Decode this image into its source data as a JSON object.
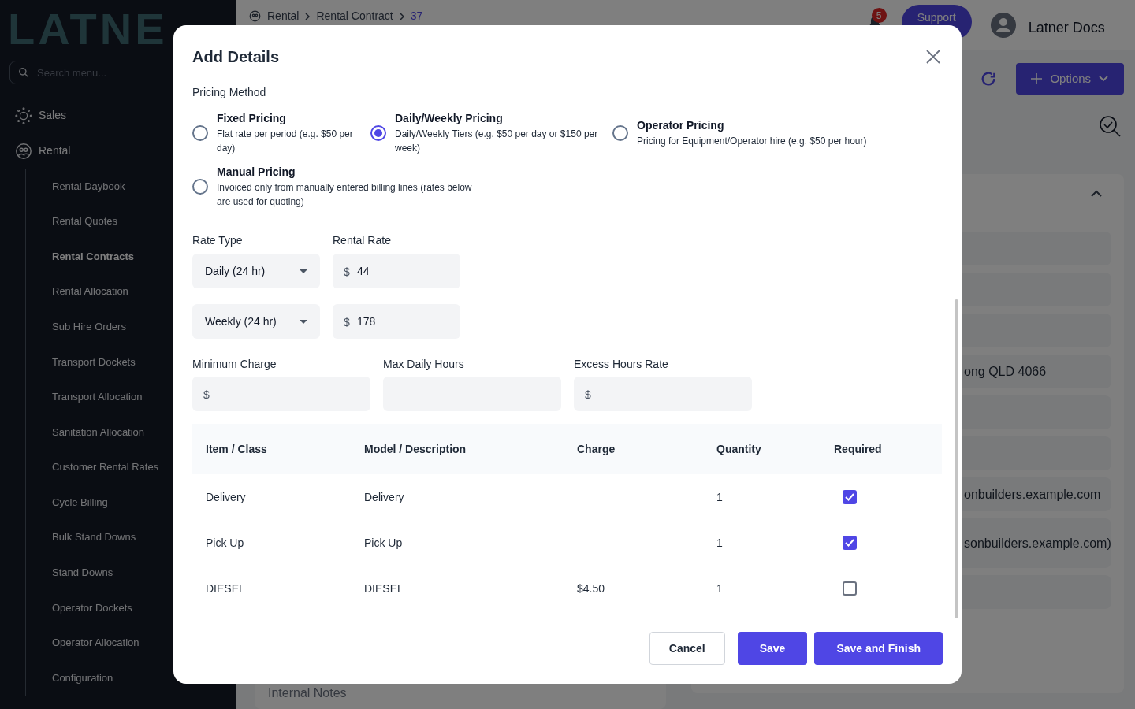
{
  "sidebar": {
    "logo": "LATNE",
    "search": {
      "placeholder": "Search menu..."
    },
    "items": [
      {
        "label": "Sales",
        "expanded": false
      },
      {
        "label": "Rental",
        "expanded": true,
        "children": [
          {
            "label": "Rental Daybook",
            "selected": false
          },
          {
            "label": "Rental Quotes",
            "selected": false
          },
          {
            "label": "Rental Contracts",
            "selected": true
          },
          {
            "label": "Rental Allocation",
            "selected": false
          },
          {
            "label": "Sub Hire Orders",
            "selected": false
          },
          {
            "label": "Transport Dockets",
            "selected": false
          },
          {
            "label": "Transport Allocation",
            "selected": false
          },
          {
            "label": "Sanitation Allocation",
            "selected": false
          },
          {
            "label": "Customer Rental Rates",
            "selected": false
          },
          {
            "label": "Cycle Billing",
            "selected": false
          },
          {
            "label": "Bulk Stand Downs",
            "selected": false
          },
          {
            "label": "Stand Downs",
            "selected": false
          },
          {
            "label": "Operator Dockets",
            "selected": false
          },
          {
            "label": "Operator Allocation",
            "selected": false
          },
          {
            "label": "Configuration",
            "selected": false
          }
        ]
      }
    ]
  },
  "header": {
    "breadcrumb": [
      "Rental",
      "Rental Contract",
      "37"
    ],
    "notifications": "5",
    "support": "Support",
    "user": "Latner Docs"
  },
  "toolbar": {
    "options": "Options"
  },
  "background_fields": [
    {
      "kind": "field"
    },
    {
      "kind": "field"
    },
    {
      "kind": "field"
    },
    {
      "kind": "field",
      "value": "ong QLD 4066"
    },
    {
      "kind": "field"
    },
    {
      "kind": "field"
    },
    {
      "kind": "field",
      "value": "onbuilders.example.com"
    },
    {
      "kind": "multiline",
      "value": "sonbuilders.example.com)"
    },
    {
      "kind": "field"
    }
  ],
  "background_notes": "Internal Notes",
  "modal": {
    "title": "Add Details",
    "pricing_method": "Pricing Method",
    "options": [
      {
        "title": "Fixed Pricing",
        "description": "Flat rate per period (e.g. $50 per day)",
        "selected": false
      },
      {
        "title": "Daily/Weekly Pricing",
        "description": "Daily/Weekly Tiers (e.g. $50 per day or $150 per week)",
        "selected": true
      },
      {
        "title": "Operator Pricing",
        "description": "Pricing for Equipment/Operator hire (e.g. $50 per hour)",
        "selected": false
      },
      {
        "title": "Manual Pricing",
        "description": "Invoiced only from manually entered billing lines (rates below are used for quoting)",
        "selected": false
      }
    ],
    "rate_type_label": "Rate Type",
    "rental_rate_label": "Rental Rate",
    "rates": [
      {
        "rate_type": "Daily (24 hr)",
        "currency": "$",
        "value": "44"
      },
      {
        "rate_type": "Weekly (24 hr)",
        "currency": "$",
        "value": "178"
      }
    ],
    "fields": [
      {
        "label": "Minimum Charge",
        "prefix": "$"
      },
      {
        "label": "Max Daily Hours"
      },
      {
        "label": "Excess Hours Rate",
        "prefix": "$"
      }
    ],
    "table": {
      "columns": [
        "Item / Class",
        "Model / Description",
        "Charge",
        "Quantity",
        "Required"
      ],
      "rows": [
        {
          "item": "Delivery",
          "description": "Delivery",
          "quantity": "1",
          "required": true
        },
        {
          "item": "Pick Up",
          "description": "Pick Up",
          "quantity": "1",
          "required": true
        },
        {
          "item": "DIESEL",
          "description": "DIESEL",
          "charge": "$4.50",
          "quantity": "1",
          "required": false
        }
      ]
    },
    "buttons": [
      {
        "label": "Cancel",
        "kind": "secondary"
      },
      {
        "label": "Save",
        "kind": "primary"
      },
      {
        "label": "Save and Finish",
        "kind": "primary"
      }
    ]
  }
}
